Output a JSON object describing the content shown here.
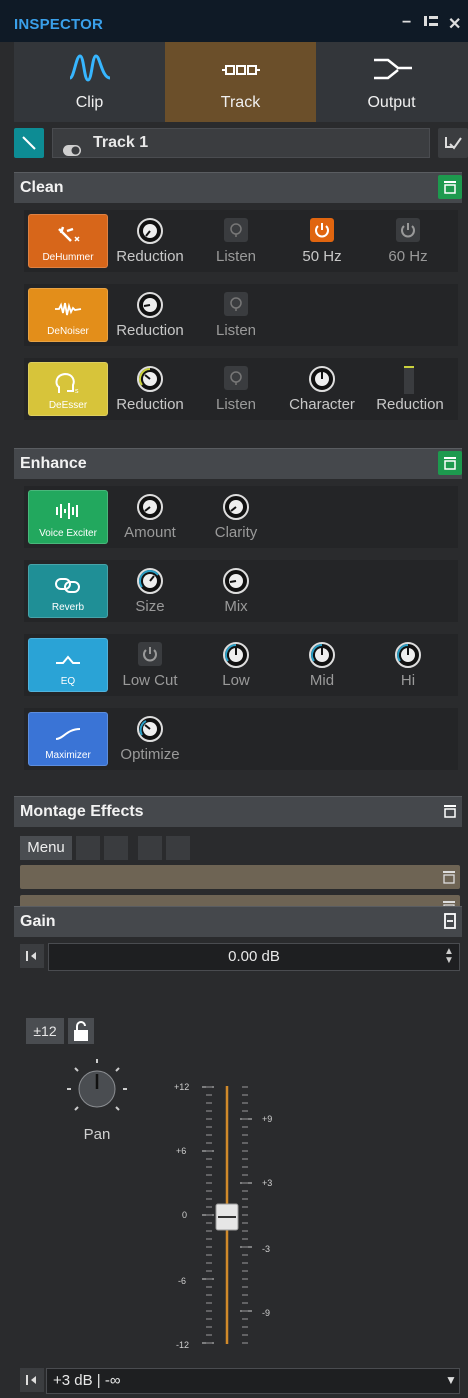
{
  "window": {
    "title": "INSPECTOR"
  },
  "tabs": [
    {
      "label": "Clip",
      "icon": "waveform-icon"
    },
    {
      "label": "Track",
      "icon": "track-chain-icon",
      "active": true
    },
    {
      "label": "Output",
      "icon": "output-merge-icon"
    }
  ],
  "track": {
    "name": "Track 1"
  },
  "sections": {
    "clean": {
      "title": "Clean"
    },
    "enhance": {
      "title": "Enhance"
    },
    "montage": {
      "title": "Montage Effects",
      "menu_label": "Menu"
    },
    "gain": {
      "title": "Gain"
    }
  },
  "clean": {
    "dehummer": {
      "label": "DeHummer",
      "color": "#d7661a",
      "controls": {
        "reduction": "Reduction",
        "listen": "Listen",
        "hz50": "50 Hz",
        "hz60": "60 Hz"
      }
    },
    "denoiser": {
      "label": "DeNoiser",
      "color": "#e38e1a",
      "controls": {
        "reduction": "Reduction",
        "listen": "Listen"
      }
    },
    "deesser": {
      "label": "DeEsser",
      "color": "#d7c43a",
      "controls": {
        "reduction": "Reduction",
        "listen": "Listen",
        "character": "Character",
        "reduction_meter": "Reduction"
      }
    }
  },
  "enhance": {
    "voice_exciter": {
      "label": "Voice Exciter",
      "color": "#22a85e",
      "controls": {
        "amount": "Amount",
        "clarity": "Clarity"
      }
    },
    "reverb": {
      "label": "Reverb",
      "color": "#1f8f96",
      "controls": {
        "size": "Size",
        "mix": "Mix"
      }
    },
    "eq": {
      "label": "EQ",
      "color": "#2aa3d6",
      "controls": {
        "low_cut": "Low Cut",
        "low": "Low",
        "mid": "Mid",
        "hi": "Hi"
      }
    },
    "maximizer": {
      "label": "Maximizer",
      "color": "#3a74d6",
      "controls": {
        "optimize": "Optimize"
      }
    }
  },
  "gain": {
    "value": "0.00 dB",
    "range_label": "±12",
    "pan_label": "Pan",
    "left_scale": [
      "+12",
      "+6",
      "0",
      "-6",
      "-12"
    ],
    "right_scale": [
      "+9",
      "+3",
      "-3",
      "-9"
    ],
    "bottom_value": "+3 dB | -∞"
  },
  "colors": {
    "accent": "#3aa0ea",
    "active_tab": "#6b4f2a",
    "section_button": "#1d9a4e",
    "power_on": "#e0650f"
  }
}
